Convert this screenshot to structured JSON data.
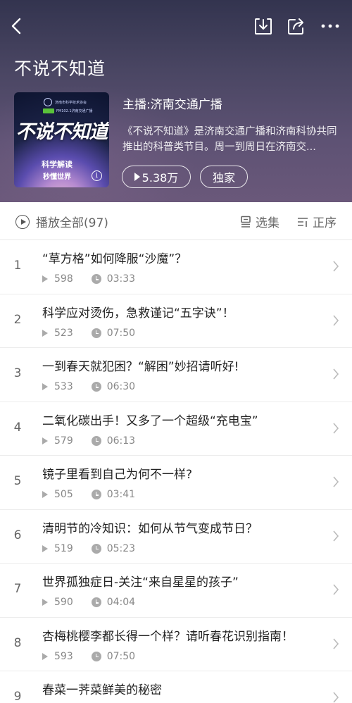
{
  "header": {
    "album_title": "不说不知道",
    "host": "主播:济南交通广播",
    "description": "《不说不知道》是济南交通广播和济南科协共同推出的科普类节目。周一到周日在济南交...",
    "plays": "5.38万",
    "exclusive": "独家"
  },
  "cover": {
    "org_text": "济南市科学技术协会",
    "sub_org_text": "FM102.1济南交通广播",
    "title": "不说不知道",
    "line1": "科学解读",
    "line2": "秒懂世界",
    "info_icon": "i"
  },
  "controls": {
    "play_all": "播放全部(97)",
    "select": "选集",
    "order": "正序"
  },
  "icons": {
    "back": "chevron-left-icon",
    "download": "download-icon",
    "share": "share-icon",
    "more": "more-icon"
  },
  "episodes": [
    {
      "index": "1",
      "title": "“草方格”如何降服“沙魔”？",
      "plays": "598",
      "duration": "03:33"
    },
    {
      "index": "2",
      "title": "科学应对烫伤，急救谨记“五字诀”！",
      "plays": "523",
      "duration": "07:50"
    },
    {
      "index": "3",
      "title": "一到春天就犯困？“解困”妙招请听好!",
      "plays": "533",
      "duration": "06:30"
    },
    {
      "index": "4",
      "title": "二氧化碳出手！又多了一个超级“充电宝”",
      "plays": "579",
      "duration": "06:13"
    },
    {
      "index": "5",
      "title": "镜子里看到自己为何不一样?",
      "plays": "505",
      "duration": "03:41"
    },
    {
      "index": "6",
      "title": "清明节的冷知识：如何从节气变成节日？",
      "plays": "519",
      "duration": "05:23"
    },
    {
      "index": "7",
      "title": "世界孤独症日-关注“来自星星的孩子”",
      "plays": "590",
      "duration": "04:04"
    },
    {
      "index": "8",
      "title": "杏梅桃樱李都长得一个样？请听春花识别指南！",
      "plays": "593",
      "duration": "07:50"
    },
    {
      "index": "9",
      "title": "春菜一荠菜鲜美的秘密",
      "plays": "",
      "duration": ""
    }
  ],
  "colors": {
    "hero_top": "#33344f",
    "hero_bottom": "#6a587a",
    "text_primary": "#222222",
    "text_secondary": "#888888"
  }
}
